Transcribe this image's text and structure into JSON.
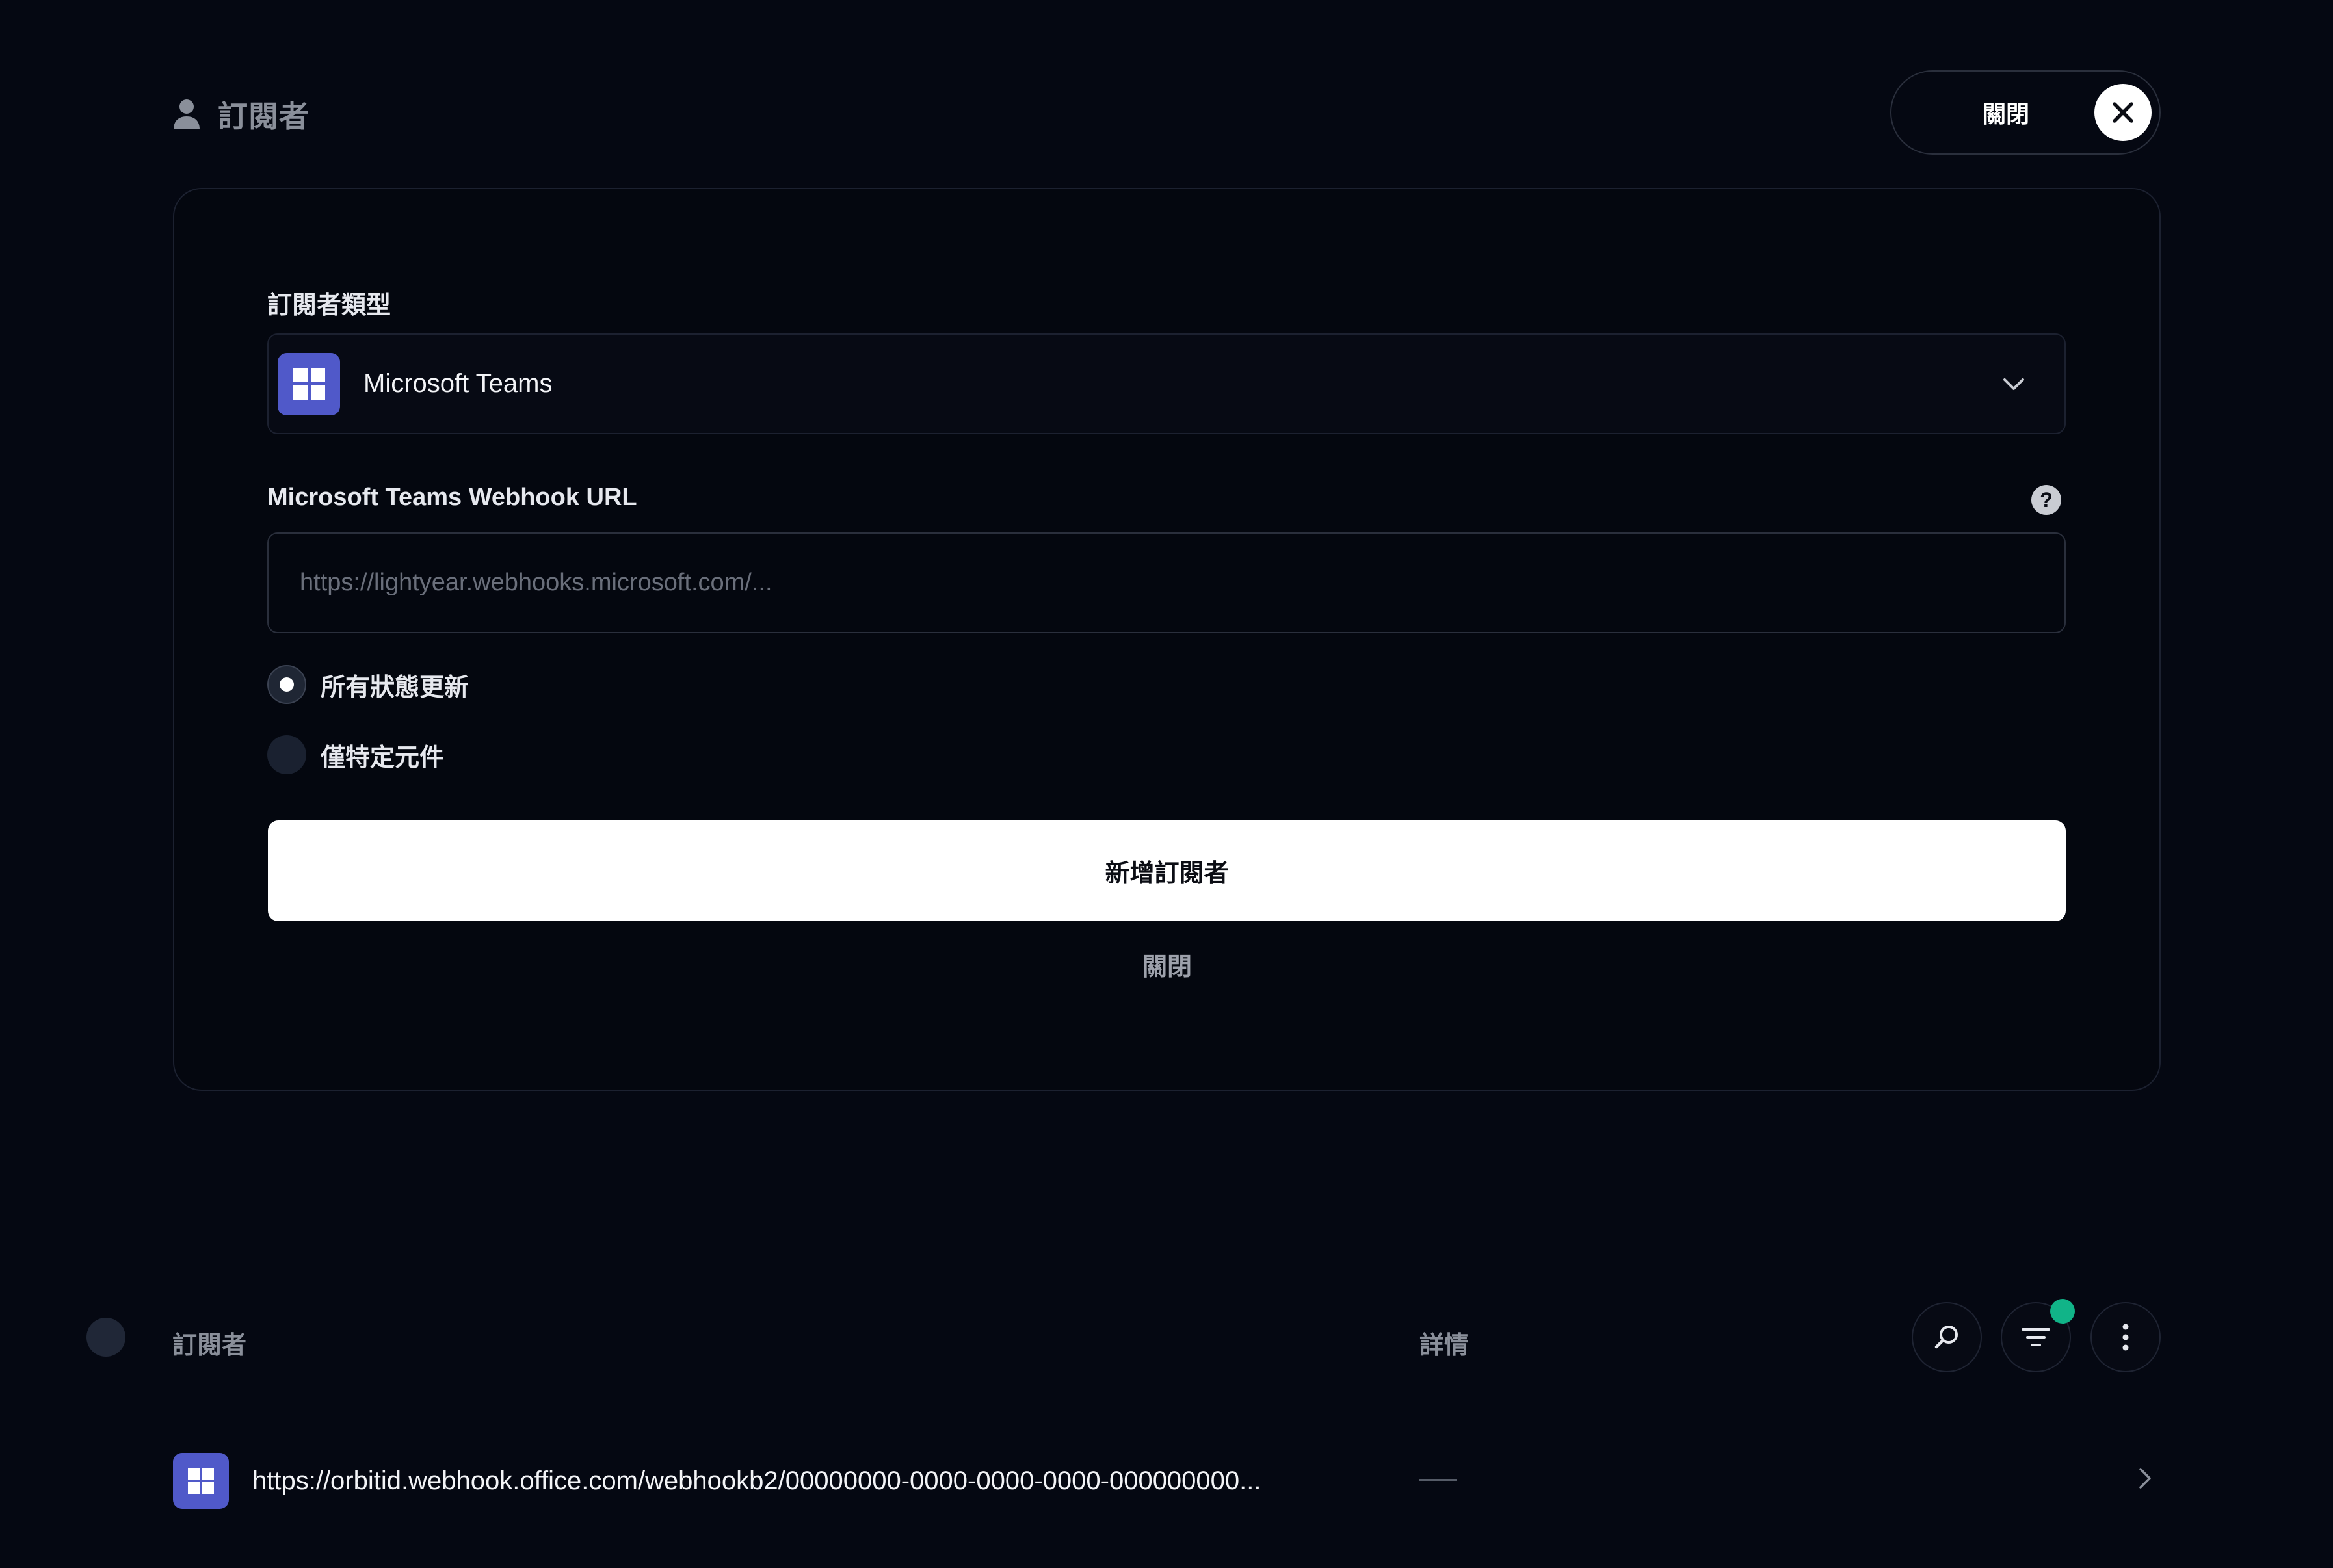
{
  "header": {
    "title": "訂閱者",
    "close_label": "關閉"
  },
  "form": {
    "type_label": "訂閱者類型",
    "type_value": "Microsoft Teams",
    "webhook_label": "Microsoft Teams Webhook URL",
    "webhook_value": "",
    "webhook_placeholder": "https://lightyear.webhooks.microsoft.com/...",
    "radio_options": [
      {
        "label": "所有狀態更新",
        "checked": true
      },
      {
        "label": "僅特定元件",
        "checked": false
      }
    ],
    "submit_label": "新增訂閱者",
    "cancel_label": "關閉"
  },
  "list": {
    "columns": [
      "訂閱者",
      "詳情"
    ],
    "filter_active": true,
    "rows": [
      {
        "url": "https://orbitid.webhook.office.com/webhookb2/00000000-0000-0000-0000-000000000...",
        "details": "—"
      }
    ]
  },
  "colors": {
    "background": "#050812",
    "teams_brand": "#5059c9",
    "filter_indicator": "#11b488"
  }
}
